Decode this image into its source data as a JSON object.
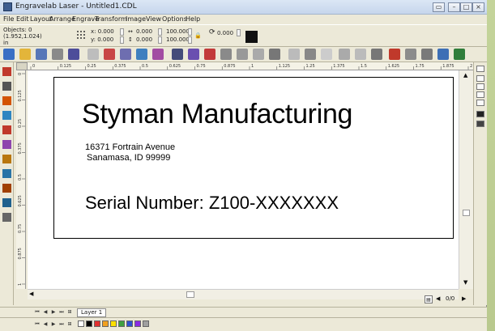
{
  "window": {
    "title": "Engravelab Laser - Untitled1.CDL"
  },
  "menu": [
    "File",
    "Edit",
    "Layout",
    "Arrange",
    "Engrave",
    "Transform",
    "Image",
    "View",
    "Options",
    "Help"
  ],
  "properties": {
    "objects_label": "Objects: 0",
    "coords_label": "(1.952,1.024)",
    "in_label": "in",
    "x_value": "x: 0.000",
    "y_value": "y: 0.000",
    "w_value": "0.000",
    "h_value": "0.000",
    "sx_value": "100.000",
    "sy_value": "100.000",
    "angle_value": "0.000"
  },
  "ruler": {
    "h_ticks": [
      "0",
      "0.125",
      "0.25",
      "0.375",
      "0.5",
      "0.625",
      "0.75",
      "0.875",
      "1",
      "1.125",
      "1.25",
      "1.375",
      "1.5",
      "1.625",
      "1.75",
      "1.875",
      "2"
    ],
    "v_ticks": [
      "0",
      "0.125",
      "0.25",
      "0.375",
      "0.5",
      "0.625",
      "0.75",
      "0.875",
      "1"
    ]
  },
  "document": {
    "company": "Styman Manufacturing",
    "address_line1": "16371 Fortrain Avenue",
    "address_line2": "Sanamasa, ID 99999",
    "serial": "Serial Number: Z100-XXXXXXX"
  },
  "pagenav": {
    "page": "0/0"
  },
  "layers": {
    "active_tab": "Layer 1"
  },
  "colors": {
    "accent": "#3d5d8f",
    "swatches": [
      "#ffffff",
      "#000000",
      "#e03030",
      "#f0a020",
      "#ffe000",
      "#40a040",
      "#3050d0",
      "#8a2be2",
      "#a0a0a0"
    ]
  }
}
